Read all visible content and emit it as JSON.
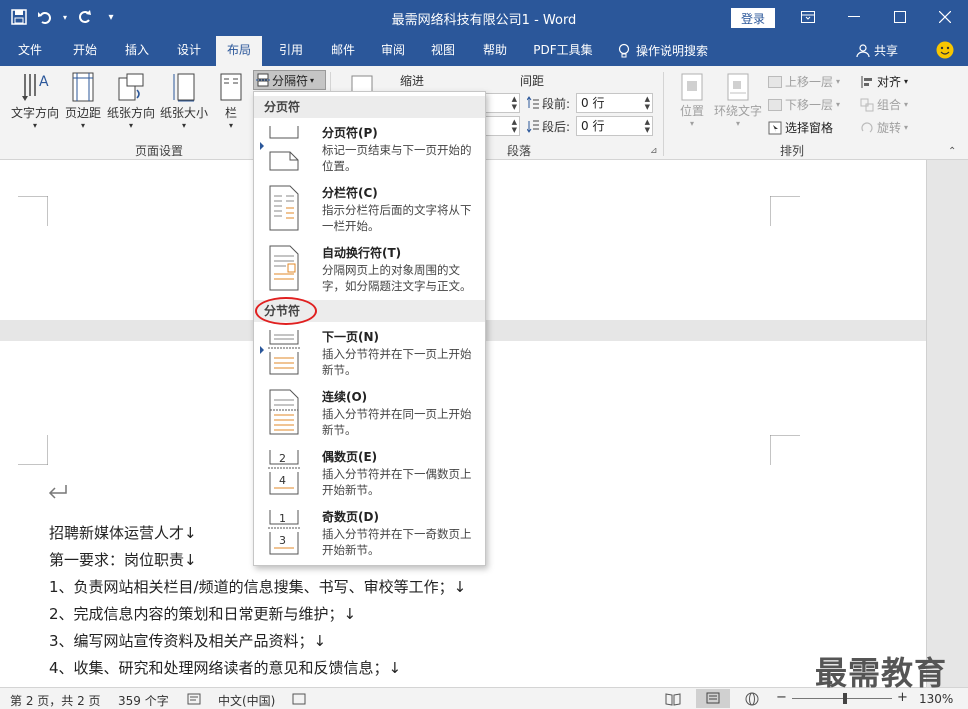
{
  "titlebar": {
    "title": "最需网络科技有限公司1 - Word",
    "login": "登录"
  },
  "tabs": [
    "文件",
    "开始",
    "插入",
    "设计",
    "布局",
    "引用",
    "邮件",
    "审阅",
    "视图",
    "帮助",
    "PDF工具集",
    "操作说明搜索"
  ],
  "active_tab": "布局",
  "share": "共享",
  "ribbon": {
    "page_setup": {
      "text_direction": "文字方向",
      "margins": "页边距",
      "orientation": "纸张方向",
      "size": "纸张大小",
      "columns": "栏",
      "breaks": "分隔符",
      "group": "页面设置"
    },
    "paragraph": {
      "indent": "缩进",
      "spacing": "间距",
      "before_label": "段前:",
      "before_value": "0 行",
      "after_label": "段后:",
      "after_value": "0 行",
      "group": "段落"
    },
    "arrange": {
      "position": "位置",
      "wrap": "环绕文字",
      "forward": "上移一层",
      "backward": "下移一层",
      "selection_pane": "选择窗格",
      "align": "对齐",
      "group_btn": "组合",
      "rotate": "旋转",
      "group": "排列"
    }
  },
  "dropdown": {
    "section_page": "分页符",
    "section_section": "分节符",
    "items": [
      {
        "title": "分页符(P)",
        "desc": "标记一页结束与下一页开始的位置。"
      },
      {
        "title": "分栏符(C)",
        "desc": "指示分栏符后面的文字将从下一栏开始。"
      },
      {
        "title": "自动换行符(T)",
        "desc": "分隔网页上的对象周围的文字，如分隔题注文字与正文。"
      },
      {
        "title": "下一页(N)",
        "desc": "插入分节符并在下一页上开始新节。"
      },
      {
        "title": "连续(O)",
        "desc": "插入分节符并在同一页上开始新节。"
      },
      {
        "title": "偶数页(E)",
        "desc": "插入分节符并在下一偶数页上开始新节。"
      },
      {
        "title": "奇数页(D)",
        "desc": "插入分节符并在下一奇数页上开始新节。"
      }
    ]
  },
  "document": {
    "lines": [
      "招聘新媒体运营人才↓",
      "第一要求：岗位职责↓",
      "1、负责网站相关栏目/频道的信息搜集、书写、审校等工作；↓",
      "2、完成信息内容的策划和日常更新与维护；↓",
      "3、编写网站宣传资料及相关产品资料；↓",
      "4、收集、研究和处理网络读者的意见和反馈信息；↓"
    ]
  },
  "statusbar": {
    "page": "第 2 页，共 2 页",
    "words": "359 个字",
    "lang": "中文(中国)",
    "zoom": "130%"
  },
  "watermark": "最需教育",
  "colors": {
    "brand": "#2b579a",
    "ribbon": "#f3f3f3",
    "highlight": "#e02020"
  }
}
